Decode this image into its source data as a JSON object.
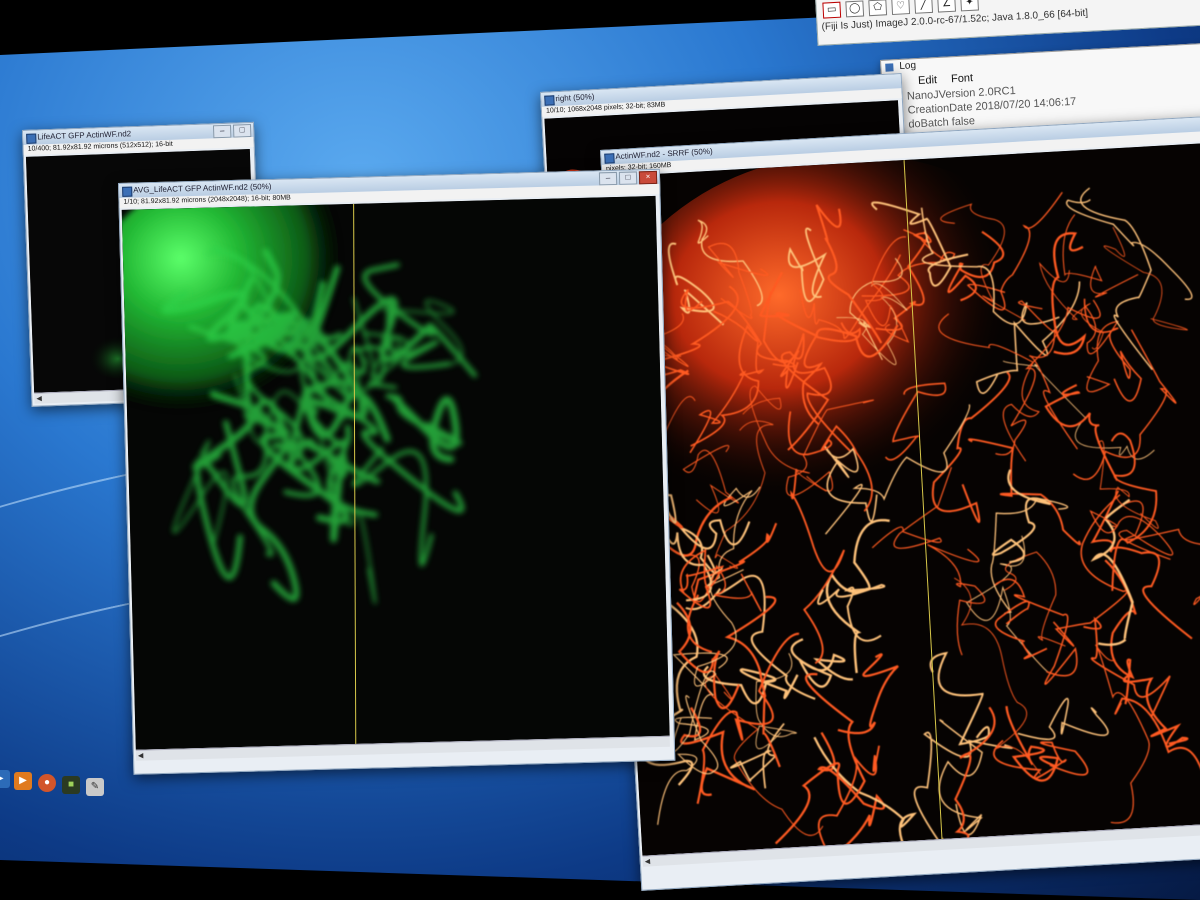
{
  "fiji": {
    "status": "(Fiji Is Just) ImageJ 2.0.0-rc-67/1.52c; Java 1.8.0_66 [64-bit]",
    "tools": [
      {
        "icon": "rectangle-tool-icon",
        "glyph": "▭"
      },
      {
        "icon": "oval-tool-icon",
        "glyph": "◯"
      },
      {
        "icon": "polygon-tool-icon",
        "glyph": "⬠"
      },
      {
        "icon": "freehand-tool-icon",
        "glyph": "♡"
      },
      {
        "icon": "line-tool-icon",
        "glyph": "╱"
      },
      {
        "icon": "angle-tool-icon",
        "glyph": "∠"
      },
      {
        "icon": "point-tool-icon",
        "glyph": "✦"
      }
    ]
  },
  "log_window": {
    "title": "Log",
    "menu": [
      "Edit",
      "Font"
    ],
    "lines": [
      "NanoJVersion 2.0RC1",
      "CreationDate 2018/07/20 14:06:17",
      "doBatch false"
    ]
  },
  "windows": {
    "small_left": {
      "title": "LifeACT GFP ActinWF.nd2",
      "info": "10/400; 81.92x81.92 microns (512x512); 16-bit"
    },
    "avg_green": {
      "title": "AVG_LifeACT GFP ActinWF.nd2 (50%)",
      "info": "1/10; 81.92x81.92 microns (2048x2048); 16-bit; 80MB"
    },
    "right": {
      "title": "right (50%)",
      "info": "10/10; 1068x2048 pixels; 32-bit; 83MB"
    },
    "srrf": {
      "title": "ActinWF.nd2 - SRRF (50%)",
      "info": "pixels; 32-bit; 160MB"
    }
  },
  "colors": {
    "green_channel": "#2fd24a",
    "red_channel": "#ff4a1c",
    "desktop_blue": "#2a78d0",
    "divider_line": "#d8c84a"
  }
}
